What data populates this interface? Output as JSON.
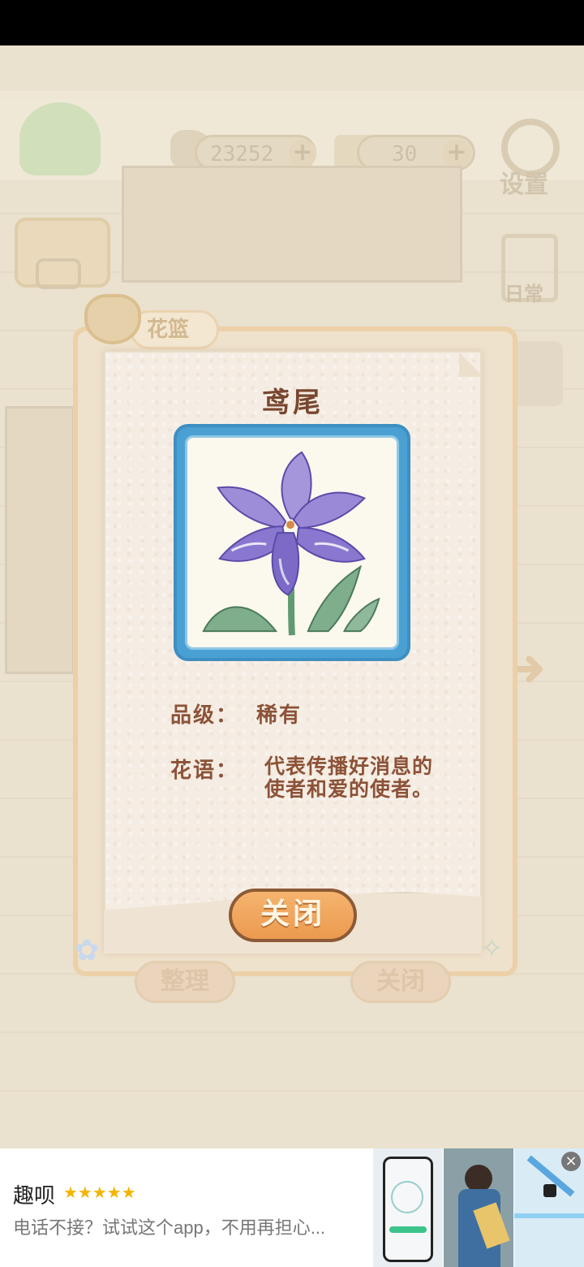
{
  "hud": {
    "fish_coins": "23252",
    "cakes": "30",
    "settings_label": "设置",
    "daily_label": "日常"
  },
  "basket": {
    "tab_label": "花篮",
    "organize_label": "整理",
    "close_label": "关闭"
  },
  "flower_card": {
    "name": "鸢尾",
    "grade_label": "品级：",
    "grade_value": "稀有",
    "language_label": "花语：",
    "language_value": "代表传播好消息的使者和爱的使者。",
    "close_button": "关闭"
  },
  "colors": {
    "frame_blue": "#4aa0d3",
    "petal_purple": "#8a78d0",
    "button_orange": "#f0a65c",
    "text_brown": "#8c5238"
  },
  "ad": {
    "app_name": "趣呗",
    "stars": "★★★★★",
    "description": "电话不接？试试这个app，不用再担心...",
    "close_icon": "×"
  }
}
